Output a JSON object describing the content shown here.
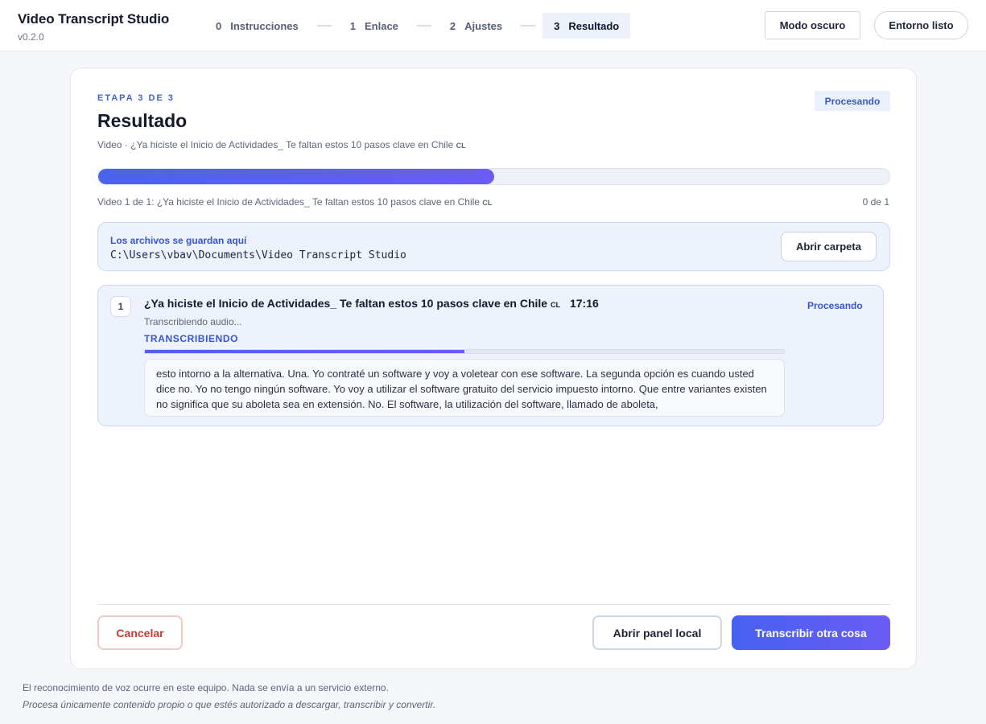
{
  "app": {
    "title": "Video Transcript Studio",
    "version": "v0.2.0"
  },
  "steps": [
    {
      "num": "0",
      "label": "Instrucciones"
    },
    {
      "num": "1",
      "label": "Enlace"
    },
    {
      "num": "2",
      "label": "Ajustes"
    },
    {
      "num": "3",
      "label": "Resultado",
      "active": true
    }
  ],
  "header": {
    "dark_mode_label": "Modo oscuro",
    "env_label": "Entorno listo"
  },
  "card": {
    "eyebrow": "ETAPA 3 DE 3",
    "title": "Resultado",
    "subtitle": "Video · ¿Ya hiciste el Inicio de Actividades_ Te faltan estos 10 pasos clave en Chile",
    "status_badge": "Procesando"
  },
  "progress": {
    "fraction": 0.5,
    "caption": "Video 1 de 1: ¿Ya hiciste el Inicio de Actividades_ Te faltan estos 10 pasos clave en Chile",
    "count": "0 de 1"
  },
  "save": {
    "label": "Los archivos se guardan aquí",
    "path": "C:\\Users\\vbav\\Documents\\Video Transcript Studio",
    "open_label": "Abrir carpeta"
  },
  "job": {
    "index": "1",
    "title": "¿Ya hiciste el Inicio de Actividades_ Te faltan estos 10 pasos clave en Chile",
    "flag": "CL",
    "duration": "17:16",
    "status": "Procesando",
    "substatus": "Transcribiendo audio...",
    "phase": "TRANSCRIBIENDO",
    "progress_fraction": 0.5,
    "transcript": "esto intorno a la alternativa. Una. Yo contraté un software y voy a voletear con ese software. La segunda opción es cuando usted dice no. Yo no tengo ningún software. Yo voy a utilizar el software gratuito del servicio impuesto intorno. Que entre variantes existen no significa que su aboleta sea en extensión. No. El software, la utilización del software, llamado de aboleta,"
  },
  "actions": {
    "cancel": "Cancelar",
    "open_local": "Abrir panel local",
    "transcribe_again": "Transcribir otra cosa"
  },
  "footer": {
    "line1": "El reconocimiento de voz ocurre en este equipo. Nada se envía a un servicio externo.",
    "line2": "Procesa únicamente contenido propio o que estés autorizado a descargar, transcribir y convertir."
  },
  "colors": {
    "accent": "#4a64ea",
    "accent_end": "#6c5cf3",
    "danger": "#c43c33"
  }
}
